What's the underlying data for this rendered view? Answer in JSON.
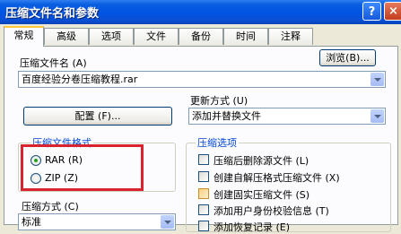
{
  "window": {
    "title": "压缩文件名和参数",
    "help": "?",
    "close": "×"
  },
  "tabs": [
    "常规",
    "高级",
    "选项",
    "文件",
    "备份",
    "时间",
    "注释"
  ],
  "active_tab": "常规",
  "archive_name": {
    "label": "压缩文件名 (A)",
    "value": "百度经验分卷压缩教程.rar",
    "browse_label": "浏览(B)..."
  },
  "update_mode": {
    "label": "更新方式 (U)",
    "value": "添加并替换文件"
  },
  "profile_button": "配置 (F)...",
  "format": {
    "title": "压缩文件格式",
    "options": [
      "RAR (R)",
      "ZIP (Z)"
    ],
    "selected": "RAR (R)"
  },
  "method": {
    "label": "压缩方式 (C)",
    "value": "标准"
  },
  "options": {
    "title": "压缩选项",
    "items": [
      {
        "label": "压缩后删除源文件 (L)",
        "checked": false
      },
      {
        "label": "创建自解压格式压缩文件 (X)",
        "checked": false
      },
      {
        "label": "创建固实压缩文件 (S)",
        "checked": false
      },
      {
        "label": "添加用户身份校验信息 (T)",
        "checked": false
      },
      {
        "label": "添加恢复记录 (E)",
        "checked": false
      }
    ]
  }
}
